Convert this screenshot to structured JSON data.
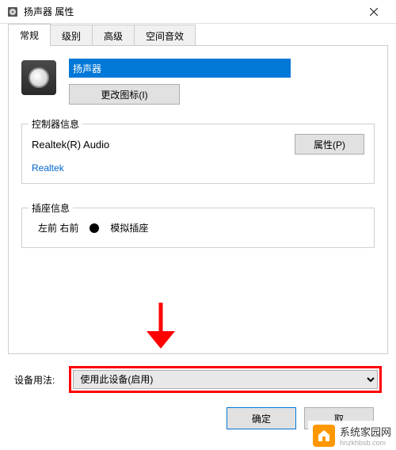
{
  "titlebar": {
    "title": "扬声器 属性"
  },
  "tabs": {
    "items": [
      {
        "label": "常规"
      },
      {
        "label": "级别"
      },
      {
        "label": "高级"
      },
      {
        "label": "空间音效"
      }
    ]
  },
  "general": {
    "device_name": "扬声器",
    "change_icon_btn": "更改图标(I)"
  },
  "controller": {
    "legend": "控制器信息",
    "name": "Realtek(R) Audio",
    "properties_btn": "属性(P)",
    "vendor": "Realtek"
  },
  "jack": {
    "legend": "插座信息",
    "position": "左前 右前",
    "type": "模拟插座"
  },
  "usage": {
    "label": "设备用法:",
    "selected": "使用此设备(启用)"
  },
  "buttons": {
    "ok": "确定",
    "cancel": "取"
  },
  "watermark": {
    "brand": "系统家园网",
    "url": "hnzkhbsb.com"
  },
  "annotation": {
    "color": "#ff0000"
  }
}
